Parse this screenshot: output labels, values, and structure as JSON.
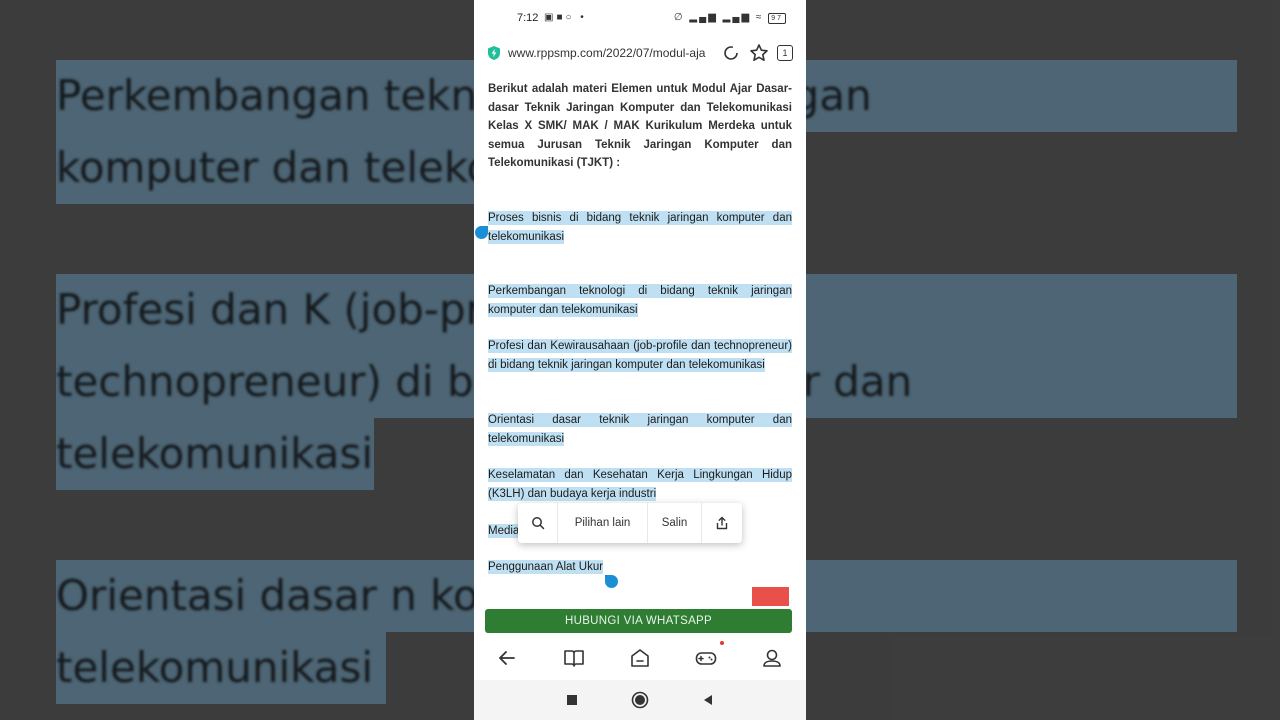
{
  "background": {
    "lines": [
      "Perkembangan    tekn                 ng    teknik    jaringan",
      "komputer dan teleko",
      "Profesi        dan        K               (job-profile       dan",
      "technopreneur) di  b              ingan komputer dan",
      "telekomunikasi",
      "Orientasi      dasar              n      komputer      dan",
      "telekomunikasi"
    ]
  },
  "status_bar": {
    "time": "7:12",
    "battery": "97"
  },
  "browser": {
    "url": "www.rppsmp.com/2022/07/modul-aja",
    "tab_count": "1"
  },
  "article": {
    "intro": "Berikut adalah materi Elemen untuk Modul Ajar Dasar-dasar Teknik Jaringan Komputer dan Telekomunikasi Kelas X SMK/ MAK / MAK Kurikulum Merdeka untuk semua Jurusan Teknik Jaringan Komputer dan Telekomunikasi (TJKT) :",
    "items": [
      "Proses bisnis di bidang teknik jaringan komputer dan telekomunikasi",
      "Perkembangan teknologi di bidang teknik jaringan komputer dan telekomunikasi",
      "Profesi dan Kewirausahaan (job-profile dan technopreneur) di bidang teknik jaringan komputer dan telekomunikasi",
      "Orientasi dasar teknik jaringan komputer dan telekomunikasi",
      "Keselamatan dan Kesehatan Kerja Lingkungan Hidup (K3LH) dan budaya kerja industri",
      "Media",
      "Penggunaan Alat Ukur"
    ]
  },
  "selection_menu": {
    "more": "Pilihan lain",
    "copy": "Salin"
  },
  "whatsapp_button": "HUBUNGI VIA WHATSAPP",
  "icons": {
    "shield": "shield-bolt-icon",
    "reload": "reload-icon",
    "star": "star-icon",
    "search": "search-icon",
    "share": "share-icon",
    "back": "back-arrow-icon",
    "reader": "book-icon",
    "home": "home-icon",
    "games": "gamepad-icon",
    "profile": "profile-icon"
  },
  "colors": {
    "selection": "#bfe0f2",
    "handle": "#1a8fd6",
    "whatsapp": "#2e7d32",
    "shield": "#1fbf9a"
  }
}
